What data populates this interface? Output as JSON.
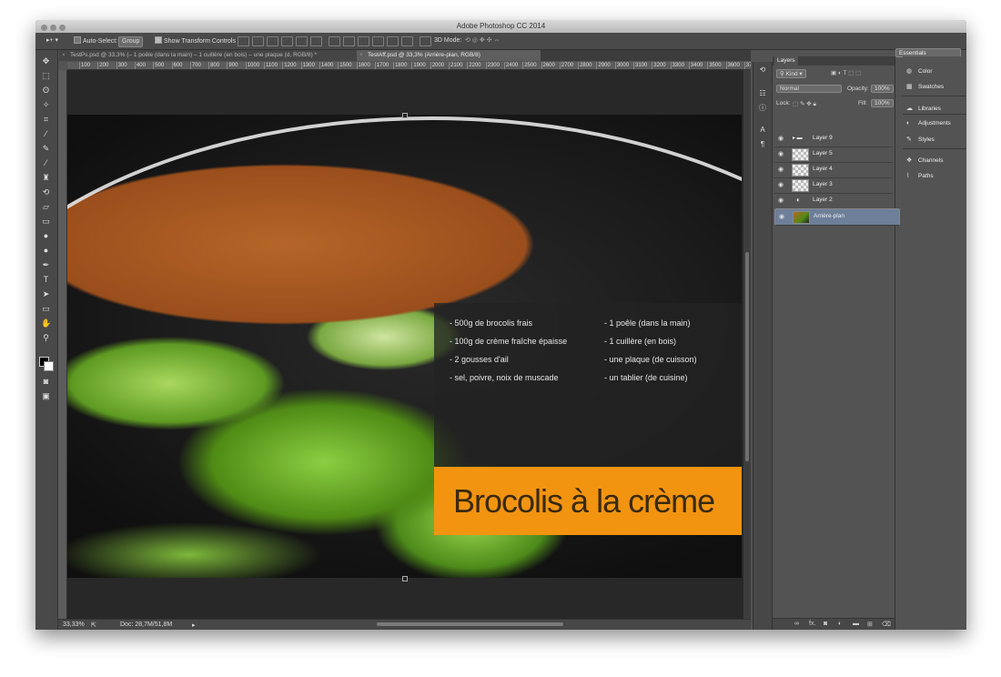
{
  "app": {
    "title": "Adobe Photoshop CC 2014"
  },
  "options_bar": {
    "auto_select_label": "Auto-Select:",
    "auto_select_value": "Group",
    "transform_label": "Show Transform Controls",
    "mode_3d_label": "3D Mode:",
    "workspace": "Essentials"
  },
  "tabs": [
    {
      "label": "TestPs.psd @ 33,3% (– 1 poêle (dans la main) – 1 cuillère (en bois) – une plaque (d, RGB/8) *"
    },
    {
      "label": "TestAff.psd @ 33,3% (Arrière-plan, RGB/8)"
    }
  ],
  "ruler": {
    "top": [
      "100",
      "200",
      "300",
      "400",
      "500",
      "600",
      "700",
      "800",
      "900",
      "1000",
      "1100",
      "1200",
      "1300",
      "1400",
      "1500",
      "1600",
      "1700",
      "1800",
      "1900",
      "2000",
      "2100",
      "2200",
      "2300",
      "2400",
      "2500",
      "2600",
      "2700",
      "2800",
      "2900",
      "3000",
      "3100",
      "3200",
      "3300",
      "3400",
      "3500",
      "3600",
      "3700"
    ]
  },
  "document": {
    "ingredients_left": [
      "- 500g de brocolis frais",
      "- 100g de crème fraîche épaisse",
      "- 2 gousses d'ail",
      "- sel, poivre, noix de muscade"
    ],
    "ingredients_right": [
      "- 1 poêle (dans la main)",
      "- 1 cuillère (en bois)",
      "- une plaque (de cuisson)",
      "- un tablier (de cuisine)"
    ],
    "title": "Brocolis à la crème",
    "colors": {
      "accent": "#f29410",
      "overlay": "#232323"
    }
  },
  "status": {
    "zoom": "33,33%",
    "doc": "Doc: 28,7M/51,8M"
  },
  "layers_panel": {
    "tab": "Layers",
    "kind": "Kind",
    "blend_mode": "Normal",
    "opacity_label": "Opacity:",
    "opacity_value": "100%",
    "lock_label": "Lock:",
    "fill_label": "Fill:",
    "fill_value": "100%",
    "layers": [
      {
        "name": "Layer 9",
        "type": "group"
      },
      {
        "name": "Layer 5",
        "type": "layer"
      },
      {
        "name": "Layer 4",
        "type": "layer"
      },
      {
        "name": "Layer 3",
        "type": "layer"
      },
      {
        "name": "Layer 2",
        "type": "adjustment"
      },
      {
        "name": "Arrière-plan",
        "type": "background",
        "selected": true
      }
    ],
    "bottom_icons": [
      "link-icon",
      "fx-icon",
      "mask-icon",
      "adjustment-icon",
      "folder-icon",
      "new-layer-icon",
      "trash-icon"
    ]
  },
  "right_panel": {
    "items": [
      {
        "label": "Color",
        "icon": "color-icon"
      },
      {
        "label": "Swatches",
        "icon": "swatches-icon"
      },
      {
        "label": "Libraries",
        "icon": "libraries-icon"
      },
      {
        "label": "Adjustments",
        "icon": "adjustments-icon"
      },
      {
        "label": "Styles",
        "icon": "styles-icon"
      },
      {
        "label": "Channels",
        "icon": "channels-icon"
      },
      {
        "label": "Paths",
        "icon": "paths-icon"
      }
    ]
  }
}
